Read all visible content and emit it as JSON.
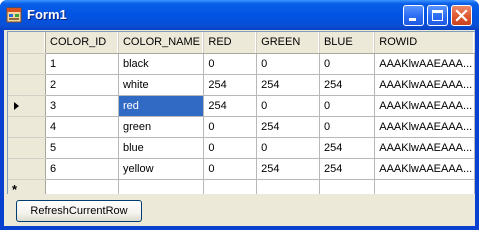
{
  "window": {
    "title": "Form1"
  },
  "grid": {
    "columns": [
      "COLOR_ID",
      "COLOR_NAME",
      "RED",
      "GREEN",
      "BLUE",
      "ROWID"
    ],
    "rows": [
      [
        "1",
        "black",
        "0",
        "0",
        "0",
        "AAAKlwAAEAAA..."
      ],
      [
        "2",
        "white",
        "254",
        "254",
        "254",
        "AAAKlwAAEAAA..."
      ],
      [
        "3",
        "red",
        "254",
        "0",
        "0",
        "AAAKlwAAEAAA..."
      ],
      [
        "4",
        "green",
        "0",
        "254",
        "0",
        "AAAKlwAAEAAA..."
      ],
      [
        "5",
        "blue",
        "0",
        "0",
        "254",
        "AAAKlwAAEAAA..."
      ],
      [
        "6",
        "yellow",
        "0",
        "254",
        "254",
        "AAAKlwAAEAAA..."
      ]
    ],
    "current_row_index": 2,
    "selected_column_index": 1,
    "new_row_marker": "*"
  },
  "buttons": {
    "refresh_label": "RefreshCurrentRow"
  },
  "colors": {
    "selection": "#316ac5",
    "titlebar": "#0054e3"
  },
  "icons": {
    "app": "form-app-icon",
    "minimize": "minimize-icon",
    "maximize": "maximize-icon",
    "close": "close-icon",
    "current_row": "current-row-arrow-icon",
    "new_row": "new-row-star-icon"
  }
}
